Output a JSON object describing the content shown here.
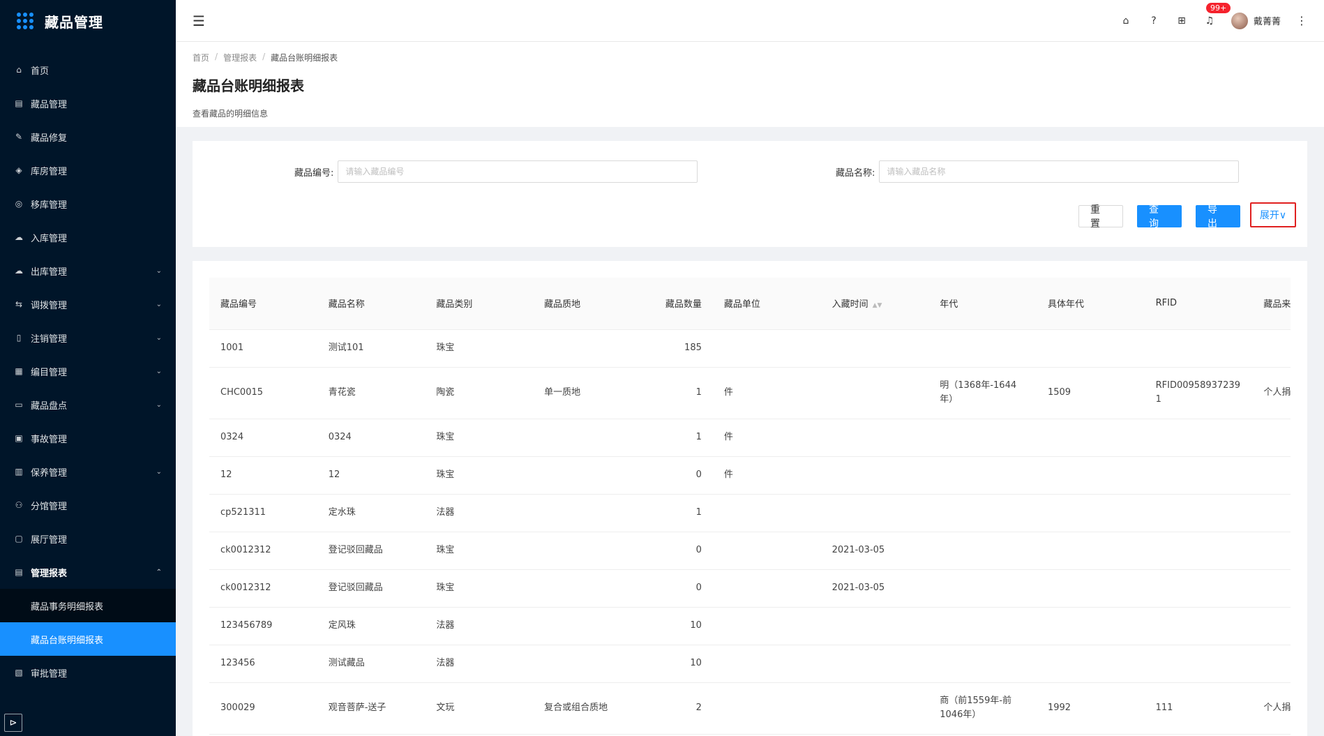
{
  "app": {
    "title": "藏品管理"
  },
  "sidebar": {
    "items": [
      {
        "label": "首页",
        "icon": "home-icon",
        "glyph": "⌂",
        "arrow": ""
      },
      {
        "label": "藏品管理",
        "icon": "calendar-icon",
        "glyph": "▤",
        "arrow": ""
      },
      {
        "label": "藏品修复",
        "icon": "wrench-icon",
        "glyph": "✎",
        "arrow": ""
      },
      {
        "label": "库房管理",
        "icon": "warehouse-icon",
        "glyph": "◈",
        "arrow": ""
      },
      {
        "label": "移库管理",
        "icon": "move-icon",
        "glyph": "◎",
        "arrow": ""
      },
      {
        "label": "入库管理",
        "icon": "cloud-upload-icon",
        "glyph": "☁",
        "arrow": ""
      },
      {
        "label": "出库管理",
        "icon": "cloud-download-icon",
        "glyph": "☁",
        "arrow": "⌄"
      },
      {
        "label": "调拨管理",
        "icon": "transfer-icon",
        "glyph": "⇆",
        "arrow": "⌄"
      },
      {
        "label": "注销管理",
        "icon": "file-icon",
        "glyph": "▯",
        "arrow": "⌄"
      },
      {
        "label": "编目管理",
        "icon": "catalog-icon",
        "glyph": "▦",
        "arrow": "⌄"
      },
      {
        "label": "藏品盘点",
        "icon": "inventory-icon",
        "glyph": "▭",
        "arrow": "⌄"
      },
      {
        "label": "事故管理",
        "icon": "accident-icon",
        "glyph": "▣",
        "arrow": ""
      },
      {
        "label": "保养管理",
        "icon": "maintenance-icon",
        "glyph": "▥",
        "arrow": "⌄"
      },
      {
        "label": "分馆管理",
        "icon": "branch-icon",
        "glyph": "⚇",
        "arrow": ""
      },
      {
        "label": "展厅管理",
        "icon": "hall-icon",
        "glyph": "▢",
        "arrow": ""
      },
      {
        "label": "管理报表",
        "icon": "report-icon",
        "glyph": "▤",
        "arrow": "⌃"
      }
    ],
    "report_sub": [
      {
        "label": "藏品事务明细报表"
      },
      {
        "label": "藏品台账明细报表"
      }
    ],
    "after": [
      {
        "label": "审批管理",
        "icon": "approval-icon",
        "glyph": "▧",
        "arrow": ""
      }
    ]
  },
  "header": {
    "badge": "99+",
    "user_name": "戴菁菁"
  },
  "breadcrumb": [
    "首页",
    "管理报表",
    "藏品台账明细报表"
  ],
  "page": {
    "title": "藏品台账明细报表",
    "desc": "查看藏品的明细信息"
  },
  "search": {
    "code_label": "藏品编号:",
    "code_placeholder": "请输入藏品编号",
    "code_value": "",
    "name_label": "藏品名称:",
    "name_placeholder": "请输入藏品名称",
    "name_value": "",
    "reset": "重置",
    "query": "查询",
    "export": "导出",
    "expand": "展开∨"
  },
  "table": {
    "columns": [
      "藏品编号",
      "藏品名称",
      "藏品类别",
      "藏品质地",
      "藏品数量",
      "藏品单位",
      "入藏时间",
      "年代",
      "具体年代",
      "RFID",
      "藏品来"
    ],
    "rows": [
      [
        "1001",
        "测试101",
        "珠宝",
        "",
        "185",
        "",
        "",
        "",
        "",
        "",
        ""
      ],
      [
        "CHC0015",
        "青花瓷",
        "陶瓷",
        "单一质地",
        "1",
        "件",
        "",
        "明（1368年-1644年）",
        "1509",
        "RFID009589372391",
        "个人捐"
      ],
      [
        "0324",
        "0324",
        "珠宝",
        "",
        "1",
        "件",
        "",
        "",
        "",
        "",
        ""
      ],
      [
        "12",
        "12",
        "珠宝",
        "",
        "0",
        "件",
        "",
        "",
        "",
        "",
        ""
      ],
      [
        "cp521311",
        "定水珠",
        "法器",
        "",
        "1",
        "",
        "",
        "",
        "",
        "",
        ""
      ],
      [
        "ck0012312",
        "登记驳回藏品",
        "珠宝",
        "",
        "0",
        "",
        "2021-03-05",
        "",
        "",
        "",
        ""
      ],
      [
        "ck0012312",
        "登记驳回藏品",
        "珠宝",
        "",
        "0",
        "",
        "2021-03-05",
        "",
        "",
        "",
        ""
      ],
      [
        "123456789",
        "定风珠",
        "法器",
        "",
        "10",
        "",
        "",
        "",
        "",
        "",
        ""
      ],
      [
        "123456",
        "测试藏品",
        "法器",
        "",
        "10",
        "",
        "",
        "",
        "",
        "",
        ""
      ],
      [
        "300029",
        "观音菩萨-送子",
        "文玩",
        "复合或组合质地",
        "2",
        "",
        "",
        "商（前1559年-前1046年）",
        "1992",
        "111",
        "个人捐"
      ]
    ]
  }
}
